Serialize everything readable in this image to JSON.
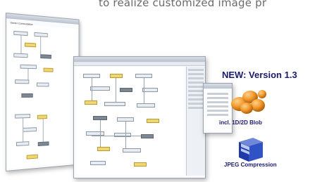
{
  "headline": {
    "text": "to realize customized image pr"
  },
  "badges": {
    "new_version": "NEW: Version 1.3",
    "blob": "incl. 1D/2D Blob",
    "jpeg": "JPEG Compression"
  },
  "window_back": {
    "title": "Gener Computation"
  },
  "colors": {
    "accent_text": "#1b1b6e",
    "node_highlight": "#f0d770",
    "headline": "#6a6a6a"
  },
  "icons": [
    "blob-orange-icon",
    "jpeg-cube-icon"
  ]
}
